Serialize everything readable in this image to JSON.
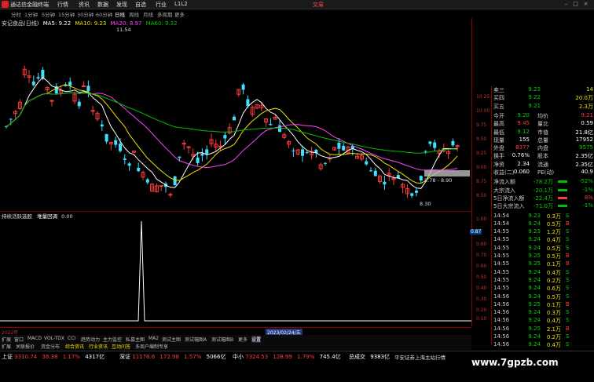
{
  "menubar": {
    "app_title": "通达信金融终端",
    "items": [
      "行情",
      "资讯",
      "数据",
      "发现",
      "自选",
      "行业",
      "L1L2"
    ],
    "trade_label": "交易"
  },
  "periods": [
    "分时",
    "1分钟",
    "5分钟",
    "15分钟",
    "30分钟",
    "60分钟",
    "日线",
    "周线",
    "月线",
    "多周期",
    "更多"
  ],
  "active_period": "日线",
  "stock_header": {
    "name": "安记食品(日线)",
    "ma5": "MA5: 9.22",
    "ma10": "MA10: 9.23",
    "ma20": "MA20: 8.97",
    "ma60": "MA60: 9.32"
  },
  "annotations": {
    "high": "11.54",
    "low": "8.30",
    "range": "8.78 - 8.90",
    "sub_value": "0.87"
  },
  "price_ticks": [
    "10.25",
    "10.00",
    "9.75",
    "9.50",
    "9.25",
    "9.00",
    "8.75",
    "8.50"
  ],
  "sub_ticks": [
    "1.00",
    "0.90",
    "0.80",
    "0.70",
    "0.60",
    "0.50",
    "0.40",
    "0.30",
    "0.20",
    "0.10",
    "0.00"
  ],
  "sub_header": {
    "name": "持续活跃选股",
    "item": "堆量回调",
    "value": "0.00"
  },
  "xaxis": {
    "left": "2022年",
    "mid": "2023/02/24/五"
  },
  "bottom_tabs": [
    "扩展",
    "窗口",
    "MACD",
    "VOL-TDX",
    "CCI",
    "趋势动力",
    "主力监控",
    "私募主图",
    "MA2",
    "测试主图",
    "测试幅图A",
    "测试幅图B",
    "更多",
    "设置"
  ],
  "bottom_tab_active": "设置",
  "status_tabs": [
    "扩展",
    "关联报价",
    "资金分布",
    "综合资讯",
    "行业资讯",
    "互动问答",
    "多周户编制专享"
  ],
  "quote_panel": {
    "asks": [
      {
        "label": "卖三",
        "price": "9.23",
        "vol": "14"
      },
      {
        "label": "买四",
        "price": "9.22",
        "vol": "20.0万"
      },
      {
        "label": "买五",
        "price": "9.21",
        "vol": "2.3万"
      }
    ],
    "stats": [
      {
        "l1": "今开",
        "v1": "9.20",
        "c1": "green",
        "l2": "均价",
        "v2": "9.21",
        "c2": "red"
      },
      {
        "l1": "最高",
        "v1": "9.45",
        "c1": "red",
        "l2": "量比",
        "v2": "0.59",
        "c2": "white"
      },
      {
        "l1": "最低",
        "v1": "9.12",
        "c1": "green",
        "l2": "市值",
        "v2": "21.8亿",
        "c2": "white"
      },
      {
        "l1": "现量",
        "v1": "155",
        "c1": "white",
        "l2": "总量",
        "v2": "17952",
        "c2": "white"
      },
      {
        "l1": "外盘",
        "v1": "8377",
        "c1": "red",
        "l2": "内盘",
        "v2": "9575",
        "c2": "green"
      },
      {
        "l1": "换手",
        "v1": "0.76%",
        "c1": "white",
        "l2": "股本",
        "v2": "2.35亿",
        "c2": "white"
      },
      {
        "l1": "净资",
        "v1": "2.34",
        "c1": "white",
        "l2": "流通",
        "v2": "2.35亿",
        "c2": "white"
      },
      {
        "l1": "收益(二)",
        "v1": "0.060",
        "c1": "white",
        "l2": "PE(动)",
        "v2": "40.9",
        "c2": "white"
      }
    ],
    "flows": [
      {
        "label": "净流入额",
        "value": "-78.2万",
        "pct": "-52%"
      },
      {
        "label": "大宗流入",
        "value": "-20.1万",
        "pct": "-1%"
      },
      {
        "label": "5日净流入额",
        "value": "-22.4万",
        "pct": "8%"
      },
      {
        "label": "5日大宗流入",
        "value": "-71.0万",
        "pct": "-1%"
      }
    ],
    "ticks": [
      {
        "t": "14:54",
        "p": "9.23",
        "v": "0.3万",
        "d": "S"
      },
      {
        "t": "14:54",
        "p": "9.24",
        "v": "0.5万",
        "d": "B"
      },
      {
        "t": "14:55",
        "p": "9.23",
        "v": "1.2万",
        "d": "S"
      },
      {
        "t": "14:55",
        "p": "9.24",
        "v": "0.4万",
        "d": "S"
      },
      {
        "t": "14:55",
        "p": "9.24",
        "v": "0.5万",
        "d": "S"
      },
      {
        "t": "14:55",
        "p": "9.25",
        "v": "0.5万",
        "d": "B"
      },
      {
        "t": "14:55",
        "p": "9.25",
        "v": "0.1万",
        "d": "B"
      },
      {
        "t": "14:55",
        "p": "9.24",
        "v": "0.4万",
        "d": "S"
      },
      {
        "t": "14:55",
        "p": "9.24",
        "v": "0.2万",
        "d": "S"
      },
      {
        "t": "14:55",
        "p": "9.24",
        "v": "0.6万",
        "d": "S"
      },
      {
        "t": "14:56",
        "p": "9.24",
        "v": "0.5万",
        "d": "S"
      },
      {
        "t": "14:56",
        "p": "9.25",
        "v": "0.1万",
        "d": "B"
      },
      {
        "t": "14:56",
        "p": "9.24",
        "v": "0.3万",
        "d": "S"
      },
      {
        "t": "14:56",
        "p": "9.24",
        "v": "0.4万",
        "d": "S"
      },
      {
        "t": "14:56",
        "p": "9.25",
        "v": "2.1万",
        "d": "B"
      },
      {
        "t": "14:56",
        "p": "9.24",
        "v": "0.2万",
        "d": "S"
      },
      {
        "t": "14:56",
        "p": "9.24",
        "v": "0.4万",
        "d": "S"
      },
      {
        "t": "14:56",
        "p": "9.24",
        "v": "0.7万",
        "d": "S"
      }
    ]
  },
  "status": {
    "sh_label": "上证",
    "sh_val": "3310.74",
    "sh_chg": "38.38",
    "sh_pct": "1.17%",
    "sh_amt": "4317亿",
    "sz_label": "深证",
    "sz_val": "11178.6",
    "sz_chg": "172.98",
    "sz_pct": "1.57%",
    "sz_amt": "5066亿",
    "cy_label": "中小",
    "cy_val": "7324.53",
    "cy_chg": "128.99",
    "cy_pct": "1.79%",
    "cy_amt": "745.4亿",
    "total_label": "总成交",
    "total_amt": "9383亿",
    "feed": "平安证券上海主站行情",
    "watermark": "www.7gpzb.com"
  },
  "colors": {
    "up": "#ff3c3c",
    "down": "#40e0ff",
    "ma5": "#ffffff",
    "ma10": "#f0e000",
    "ma20": "#ff40ff",
    "ma60": "#00c000"
  }
}
